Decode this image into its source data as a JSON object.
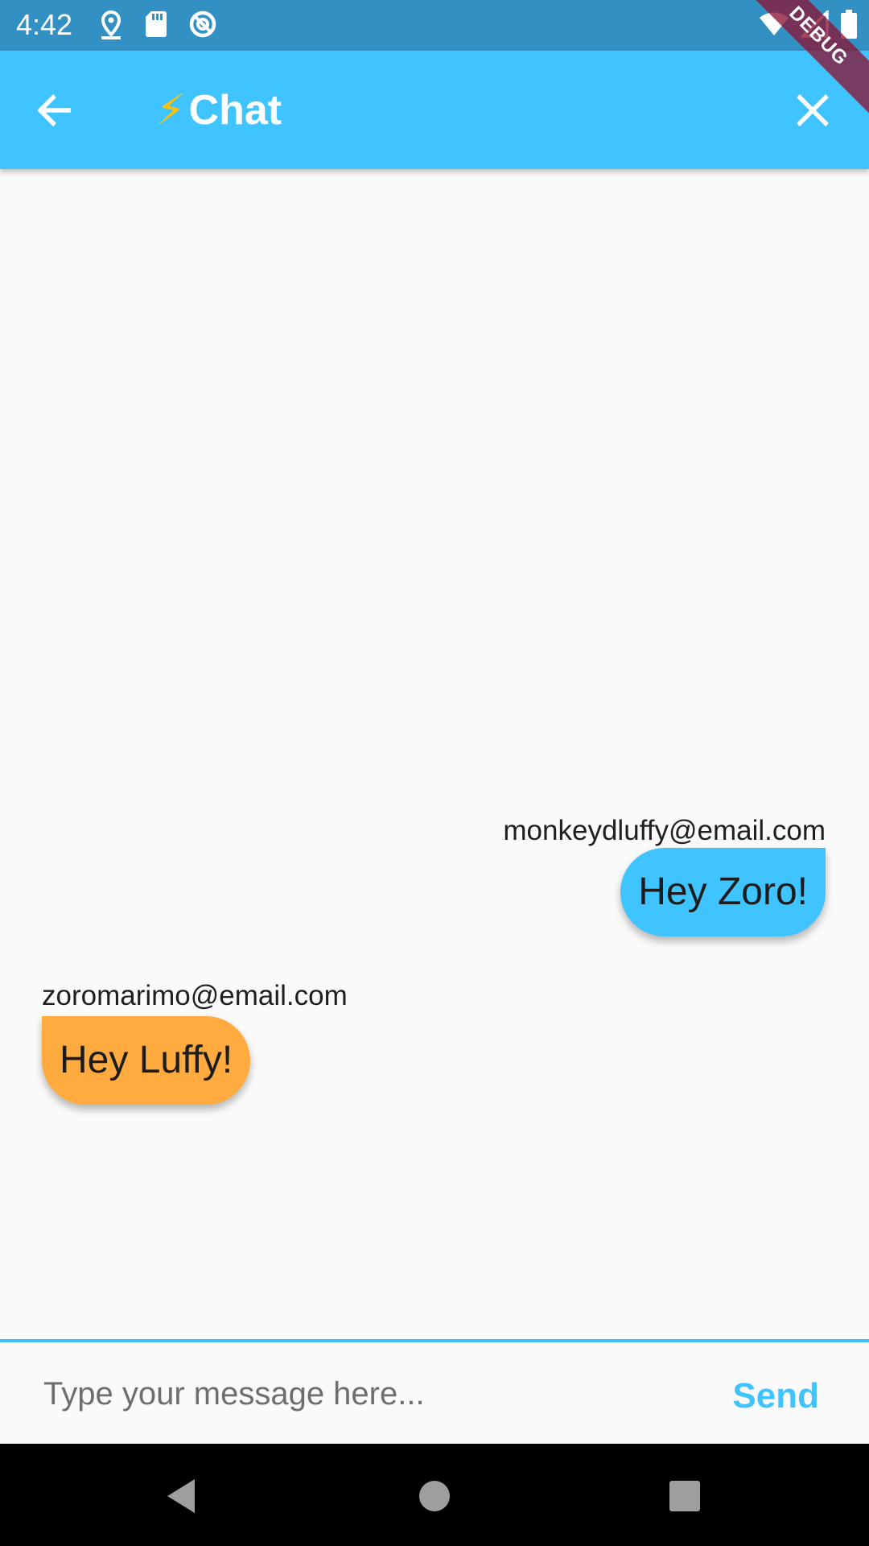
{
  "status_bar": {
    "time": "4:42",
    "icons_left": [
      "location-icon",
      "sd-card-icon",
      "sync-icon"
    ],
    "icons_right": [
      "wifi-icon",
      "signal-icon",
      "battery-icon"
    ]
  },
  "app_bar": {
    "title": "Chat",
    "title_emoji": "⚡",
    "back_icon": "arrow-back-icon",
    "close_icon": "close-icon",
    "color": "#40c4ff"
  },
  "debug_banner": "DEBUG",
  "messages": [
    {
      "sender": "monkeydluffy@email.com",
      "text": "Hey Zoro!",
      "is_me": true,
      "color": "#40c4ff"
    },
    {
      "sender": "zoromarimo@email.com",
      "text": "Hey Luffy!",
      "is_me": false,
      "color": "#ffab40"
    }
  ],
  "composer": {
    "placeholder": "Type your message here...",
    "value": "",
    "send_label": "Send"
  },
  "nav_bar": {
    "icons": [
      "back-triangle-icon",
      "home-circle-icon",
      "recents-square-icon"
    ]
  }
}
